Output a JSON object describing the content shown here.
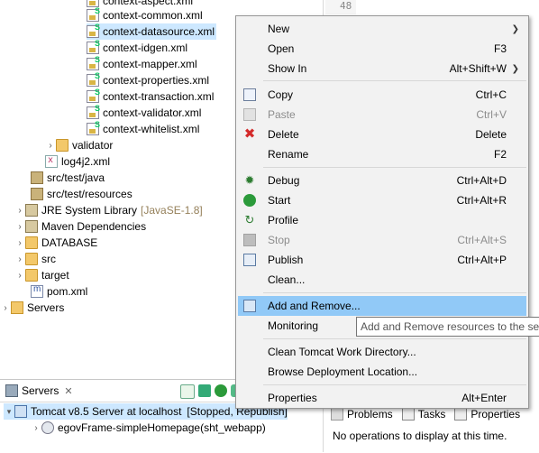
{
  "explorer": {
    "items": [
      {
        "label": "context-aspect.xml",
        "icon": "spring-xml-icon"
      },
      {
        "label": "context-common.xml",
        "icon": "spring-xml-icon"
      },
      {
        "label": "context-datasource.xml",
        "icon": "spring-xml-icon"
      },
      {
        "label": "context-idgen.xml",
        "icon": "spring-xml-icon"
      },
      {
        "label": "context-mapper.xml",
        "icon": "spring-xml-icon"
      },
      {
        "label": "context-properties.xml",
        "icon": "spring-xml-icon"
      },
      {
        "label": "context-transaction.xml",
        "icon": "spring-xml-icon"
      },
      {
        "label": "context-validator.xml",
        "icon": "spring-xml-icon"
      },
      {
        "label": "context-whitelist.xml",
        "icon": "spring-xml-icon"
      },
      {
        "label": "validator",
        "icon": "folder-icon"
      },
      {
        "label": "log4j2.xml",
        "icon": "xml-file-icon"
      },
      {
        "label": "src/test/java",
        "icon": "package-folder-icon"
      },
      {
        "label": "src/test/resources",
        "icon": "package-folder-icon"
      },
      {
        "label": "JRE System Library",
        "decoration": "[JavaSE-1.8]",
        "icon": "library-icon"
      },
      {
        "label": "Maven Dependencies",
        "icon": "library-icon"
      },
      {
        "label": "DATABASE",
        "icon": "folder-icon"
      },
      {
        "label": "src",
        "icon": "folder-icon"
      },
      {
        "label": "target",
        "icon": "folder-icon"
      },
      {
        "label": "pom.xml",
        "icon": "pom-icon"
      },
      {
        "label": "Servers",
        "icon": "project-folder-icon"
      }
    ]
  },
  "editor": {
    "line_number": "48"
  },
  "servers_view": {
    "tab_label": "Servers",
    "server_label": "Tomcat v8.5 Server at localhost",
    "server_state": "[Stopped, Republish]",
    "module_label": "egovFrame-simpleHomepage(sht_webapp)"
  },
  "properties_view": {
    "tabs": [
      "Problems",
      "Tasks",
      "Properties"
    ],
    "status": "No operations to display at this time."
  },
  "context_menu": {
    "items": [
      {
        "label": "New",
        "shortcut": "",
        "submenu": true
      },
      {
        "label": "Open",
        "shortcut": "F3"
      },
      {
        "label": "Show In",
        "shortcut": "Alt+Shift+W",
        "submenu": true
      },
      {
        "label": "Copy",
        "shortcut": "Ctrl+C",
        "icon": "copy-icon"
      },
      {
        "label": "Paste",
        "shortcut": "Ctrl+V",
        "icon": "paste-icon",
        "disabled": true
      },
      {
        "label": "Delete",
        "shortcut": "Delete",
        "icon": "delete-icon"
      },
      {
        "label": "Rename",
        "shortcut": "F2"
      },
      {
        "label": "Debug",
        "shortcut": "Ctrl+Alt+D",
        "icon": "debug-icon"
      },
      {
        "label": "Start",
        "shortcut": "Ctrl+Alt+R",
        "icon": "start-icon"
      },
      {
        "label": "Profile",
        "shortcut": "",
        "icon": "profile-icon"
      },
      {
        "label": "Stop",
        "shortcut": "Ctrl+Alt+S",
        "icon": "stop-icon",
        "disabled": true
      },
      {
        "label": "Publish",
        "shortcut": "Ctrl+Alt+P",
        "icon": "publish-icon"
      },
      {
        "label": "Clean...",
        "shortcut": ""
      },
      {
        "label": "Add and Remove...",
        "shortcut": "",
        "icon": "add-remove-icon",
        "highlighted": true
      },
      {
        "label": "Monitoring",
        "shortcut": "",
        "submenu": true
      },
      {
        "label": "Clean Tomcat Work Directory...",
        "shortcut": ""
      },
      {
        "label": "Browse Deployment Location...",
        "shortcut": ""
      },
      {
        "label": "Properties",
        "shortcut": "Alt+Enter"
      }
    ]
  },
  "tooltip": {
    "text": "Add and Remove resources to the se"
  },
  "colors": {
    "menu_highlight": "#91c9f7",
    "selection": "#cde8ff"
  }
}
